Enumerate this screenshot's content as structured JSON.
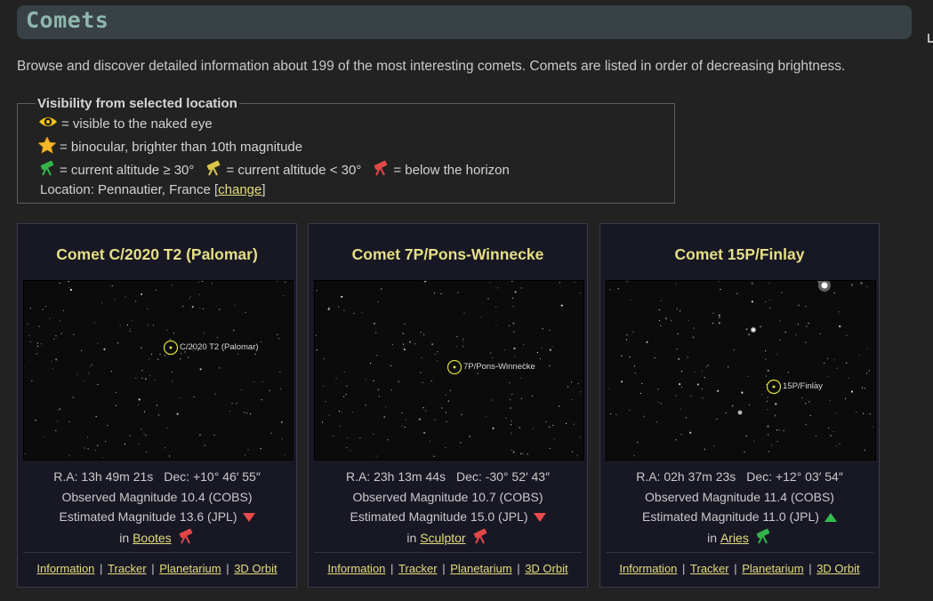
{
  "page": {
    "title": "Comets",
    "intro": "Browse and discover detailed information about 199 of the most interesting comets. Comets are listed in order of decreasing brightness."
  },
  "legend": {
    "title": "Visibility from selected location",
    "naked_eye": "= visible to the naked eye",
    "binocular": "= binocular, brighter than 10th magnitude",
    "alt_high": "= current altitude ≥ 30°",
    "alt_low": "= current altitude < 30°",
    "below": "= below the horizon",
    "location_prefix": "Location: Pennautier, France [",
    "change_link": "change",
    "location_suffix": "]"
  },
  "colors": {
    "telescope_green": "#33b34a",
    "telescope_yellow": "#d9c64a",
    "telescope_red": "#e04848",
    "trend_down": "#e84b4b",
    "trend_up": "#2fbf4a"
  },
  "comets": [
    {
      "name": "Comet C/2020 T2 (Palomar)",
      "label": "C/2020 T2 (Palomar)",
      "ra": "R.A: 13h 49m 21s",
      "dec": "Dec: +10° 46′ 55″",
      "observed": "Observed Magnitude 10.4 (COBS)",
      "estimated": "Estimated Magnitude 13.6 (JPL)",
      "trend": "down",
      "in": "in",
      "constellation": "Bootes",
      "visibility": "below-horizon",
      "links": [
        "Information",
        "Tracker",
        "Planetarium",
        "3D Orbit"
      ]
    },
    {
      "name": "Comet 7P/Pons-Winnecke",
      "label": "7P/Pons-Winnecke",
      "ra": "R.A: 23h 13m 44s",
      "dec": "Dec: -30° 52′ 43″",
      "observed": "Observed Magnitude 10.7 (COBS)",
      "estimated": "Estimated Magnitude 15.0 (JPL)",
      "trend": "down",
      "in": "in",
      "constellation": "Sculptor",
      "visibility": "below-horizon",
      "links": [
        "Information",
        "Tracker",
        "Planetarium",
        "3D Orbit"
      ]
    },
    {
      "name": "Comet 15P/Finlay",
      "label": "15P/Finlay",
      "ra": "R.A: 02h 37m 23s",
      "dec": "Dec: +12° 03′ 54″",
      "observed": "Observed Magnitude 11.4 (COBS)",
      "estimated": "Estimated Magnitude 11.0 (JPL)",
      "trend": "up",
      "in": "in",
      "constellation": "Aries",
      "visibility": "altitude-high",
      "links": [
        "Information",
        "Tracker",
        "Planetarium",
        "3D Orbit"
      ]
    }
  ]
}
